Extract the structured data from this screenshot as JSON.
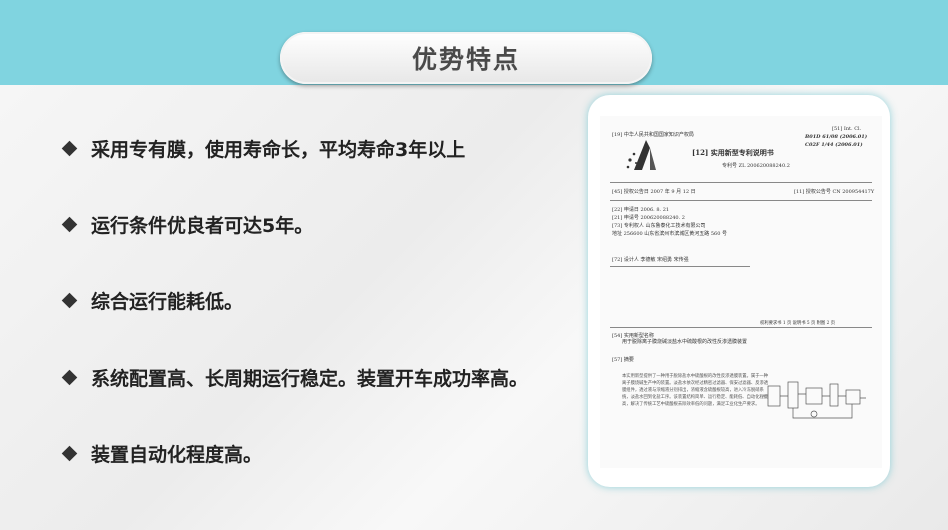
{
  "title": "优势特点",
  "bullets": [
    "采用专有膜，使用寿命长，平均寿命3年以上",
    "运行条件优良者可达5年。",
    "综合运行能耗低。",
    "系统配置高、长周期运行稳定。装置开车成功率高。",
    "装置自动化程度高。"
  ],
  "document": {
    "issuer": "[19] 中华人民共和国国家知识产权局",
    "intcl_label": "[51] Int. Cl.",
    "intcl_1": "B01D 61/08 (2006.01)",
    "intcl_2": "C02F 1/44 (2006.01)",
    "doc_type": "[12] 实用新型专利说明书",
    "patent_no": "专利号 ZL 200620088240.2",
    "grant_date": "[45] 授权公告日 2007 年 9 月 12 日",
    "grant_no": "[11] 授权公告号 CN 200954417Y",
    "app_date": "[22] 申请日 2006. 8. 21",
    "app_no": "[21] 申请号 200620088240. 2",
    "holder": "[73] 专利权人 山东鲁泰化工技术有限公司",
    "address": "地址 256600 山东省滨州市滨城区黄河五路 560 号",
    "designer": "[72] 设计人 李德敏  宋绍勇  宋传强",
    "pages_note": "权利要求书 1 页  说明书 5 页  附图 2 页",
    "name_label": "[54] 实用新型名称",
    "name_text": "用于脱除离子膜烧碱淡盐水中硫酸根的改性反渗透膜装置",
    "abstract_label": "[57] 摘要",
    "abstract_text": "本实用新型提供了一种用于脱除盐水中硫酸根的改性反渗透膜装置。属于一种离子膜烧碱生产中的装置。淡盐水依次经过精密过滤器、保安过滤器、反渗透膜组件，透过液与浓缩液分别排出，浓缩液含硫酸根较高，进入冷冻脱硝系统，淡盐水回到化盐工序。该装置结构简单、运行稳定、能耗低、自动化程度高，解决了传统工艺中硫酸根去除效率低的问题，满足工业化生产要求。"
  }
}
